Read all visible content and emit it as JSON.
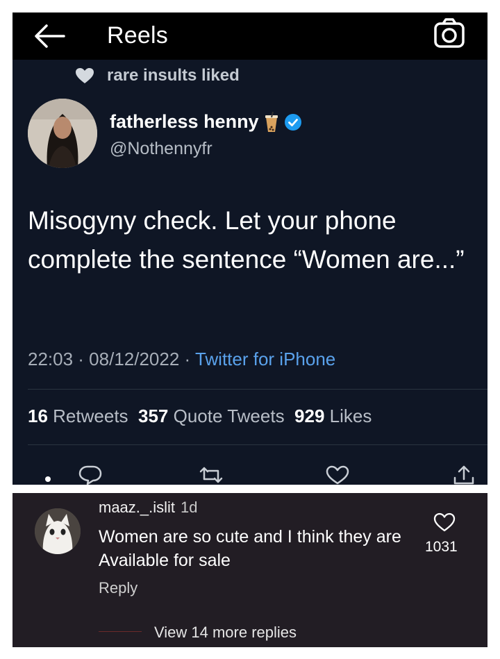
{
  "header": {
    "title": "Reels",
    "back_icon": "arrow-left-icon",
    "camera_icon": "camera-icon"
  },
  "tweet": {
    "liked_by": "rare insults liked",
    "author_name": "fatherless henny",
    "handle": "@Nothennyfr",
    "text": "Misogyny check. Let your phone complete the sentence “Women are...”",
    "timestamp": "22:03 · 08/12/2022 · ",
    "source": "Twitter for iPhone",
    "stats": {
      "retweets_count": "16",
      "retweets_label": "Retweets",
      "quotes_count": "357",
      "quotes_label": "Quote Tweets",
      "likes_count": "929",
      "likes_label": "Likes"
    },
    "verified_color": "#1d9bf0",
    "actions": [
      "reply-icon",
      "retweet-icon",
      "like-icon",
      "share-icon"
    ]
  },
  "comment": {
    "username": "maaz._.islit",
    "time": "1d",
    "text": "Women are so cute and I think they are Available for sale",
    "reply_label": "Reply",
    "like_count": "1031",
    "view_more": "View 14 more replies"
  }
}
